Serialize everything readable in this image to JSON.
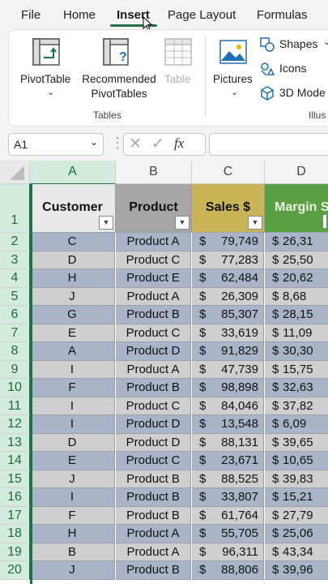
{
  "tabs": [
    "File",
    "Home",
    "Insert",
    "Page Layout",
    "Formulas"
  ],
  "active_tab": "Insert",
  "ribbon": {
    "pivottable_label": "PivotTable",
    "recommended_label_1": "Recommended",
    "recommended_label_2": "PivotTables",
    "table_label": "Table",
    "tables_group": "Tables",
    "pictures_label": "Pictures",
    "shapes_label": "Shapes",
    "icons_label": "Icons",
    "models_label": "3D Mode",
    "illustrations_group": "Illus"
  },
  "formula_bar": {
    "name_box": "A1",
    "fx": "fx"
  },
  "columns": [
    "A",
    "B",
    "C",
    "D"
  ],
  "headers": {
    "customer": "Customer",
    "product": "Product",
    "sales": "Sales $",
    "margin": "Margin S"
  },
  "header_row_number": "1",
  "rows": [
    {
      "n": "2",
      "customer": "C",
      "product": "Product A",
      "sales": "79,749",
      "margin": "26,31"
    },
    {
      "n": "3",
      "customer": "D",
      "product": "Product C",
      "sales": "77,283",
      "margin": "25,50"
    },
    {
      "n": "4",
      "customer": "H",
      "product": "Product E",
      "sales": "62,484",
      "margin": "20,62"
    },
    {
      "n": "5",
      "customer": "J",
      "product": "Product A",
      "sales": "26,309",
      "margin": "8,68"
    },
    {
      "n": "6",
      "customer": "G",
      "product": "Product B",
      "sales": "85,307",
      "margin": "28,15"
    },
    {
      "n": "7",
      "customer": "E",
      "product": "Product C",
      "sales": "33,619",
      "margin": "11,09"
    },
    {
      "n": "8",
      "customer": "A",
      "product": "Product D",
      "sales": "91,829",
      "margin": "30,30"
    },
    {
      "n": "9",
      "customer": "I",
      "product": "Product A",
      "sales": "47,739",
      "margin": "15,75"
    },
    {
      "n": "10",
      "customer": "F",
      "product": "Product B",
      "sales": "98,898",
      "margin": "32,63"
    },
    {
      "n": "11",
      "customer": "I",
      "product": "Product C",
      "sales": "84,046",
      "margin": "37,82"
    },
    {
      "n": "12",
      "customer": "I",
      "product": "Product D",
      "sales": "13,548",
      "margin": "6,09"
    },
    {
      "n": "13",
      "customer": "D",
      "product": "Product D",
      "sales": "88,131",
      "margin": "39,65"
    },
    {
      "n": "14",
      "customer": "E",
      "product": "Product C",
      "sales": "23,671",
      "margin": "10,65"
    },
    {
      "n": "15",
      "customer": "J",
      "product": "Product B",
      "sales": "88,525",
      "margin": "39,83"
    },
    {
      "n": "16",
      "customer": "I",
      "product": "Product B",
      "sales": "33,807",
      "margin": "15,21"
    },
    {
      "n": "17",
      "customer": "F",
      "product": "Product B",
      "sales": "61,764",
      "margin": "27,79"
    },
    {
      "n": "18",
      "customer": "H",
      "product": "Product A",
      "sales": "55,705",
      "margin": "25,06"
    },
    {
      "n": "19",
      "customer": "B",
      "product": "Product A",
      "sales": "96,311",
      "margin": "43,34"
    },
    {
      "n": "20",
      "customer": "J",
      "product": "Product B",
      "sales": "88,806",
      "margin": "39,96"
    }
  ],
  "currency_symbol": "$",
  "colors": {
    "accent": "#1e7145",
    "customer_header": "#e8e8e8",
    "product_header": "#a6a6a6",
    "sales_header": "#c9b458",
    "margin_header": "#5b9f44",
    "row_dark": "#a9b4c9",
    "row_light": "#cfcfcf"
  }
}
